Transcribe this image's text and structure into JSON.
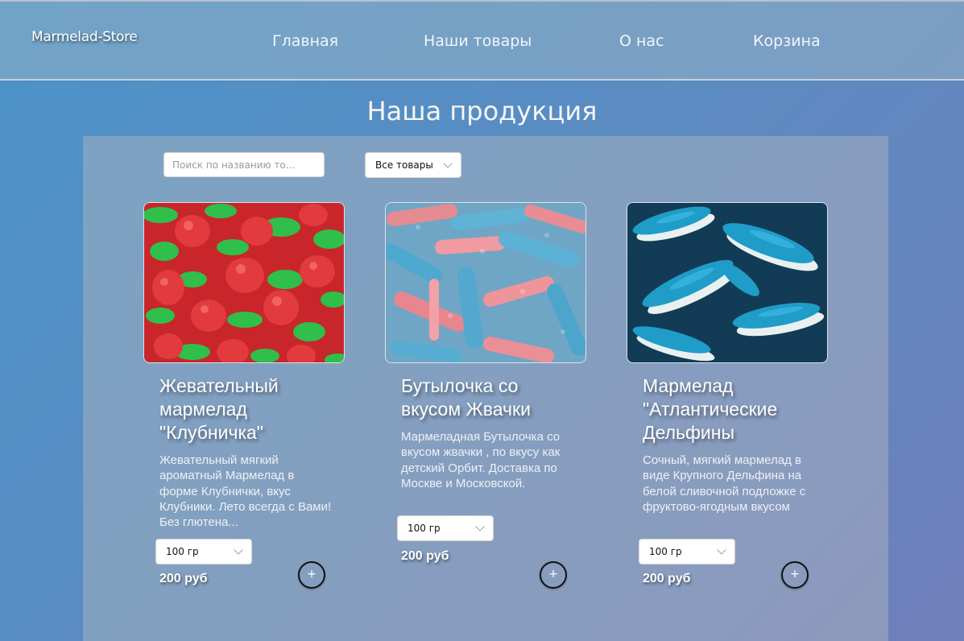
{
  "header": {
    "logo": "Marmelad-Store",
    "nav": [
      "Главная",
      "Наши товары",
      "О нас",
      "Корзина"
    ]
  },
  "page_title": "Наша продукция",
  "filters": {
    "search_placeholder": "Поиск по названию то...",
    "category_selected": "Все товары"
  },
  "products": [
    {
      "title": "Жевательный мармелад \"Клубничка\"",
      "description": "Жевательный мягкий ароматный Мармелад в форме Клубнички, вкус Клубники. Лето всегда с Вами! Без глютена...",
      "weight": "100 гр",
      "price": "200 руб",
      "add_label": "+",
      "image": "strawberry-gummies"
    },
    {
      "title": "Бутылочка со вкусом Жвачки",
      "description": "Мармеладная Бутылочка со вкусом жвачки , по вкусу как детский Орбит. Доставка по Москве и Московской.",
      "weight": "100 гр",
      "price": "200 руб",
      "add_label": "+",
      "image": "bubblegum-bottle-gummies"
    },
    {
      "title": "Мармелад \"Атлантические Дельфины",
      "description": "Сочный, мягкий мармелад в виде Крупного Дельфина на белой сливочной подложке с фруктово-ягодным вкусом",
      "weight": "100 гр",
      "price": "200 руб",
      "add_label": "+",
      "image": "dolphin-gummies"
    }
  ]
}
